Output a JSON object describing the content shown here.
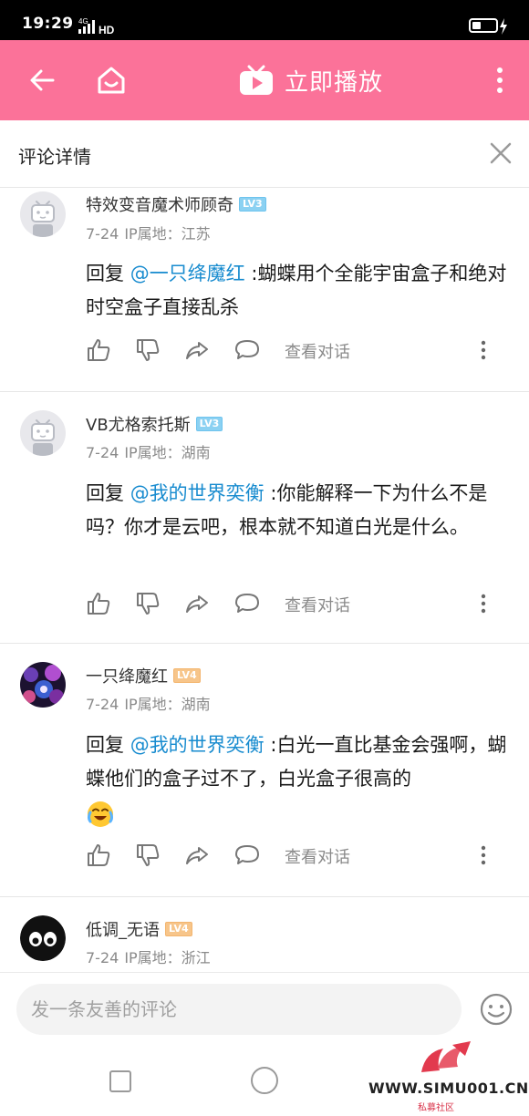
{
  "status_bar": {
    "time": "19:29",
    "network": "4G",
    "hd": "HD"
  },
  "header": {
    "play_label": "立即播放",
    "accent_color": "#fb7299"
  },
  "subheader": {
    "title": "评论详情"
  },
  "comments": [
    {
      "username": "特效变音魔术师顾奇",
      "level": "LV3",
      "date": "7-24",
      "ip": "IP属地：江苏",
      "reply_prefix": "回复 ",
      "mention": "@一只绛魔红",
      "text": " :蝴蝶用个全能宇宙盒子和绝对时空盒子直接乱杀",
      "view_dialog": "查看对话"
    },
    {
      "username": "VB尤格索托斯",
      "level": "LV3",
      "date": "7-24",
      "ip": "IP属地：湖南",
      "reply_prefix": "回复 ",
      "mention": "@我的世界奕衡",
      "text": " :你能解释一下为什么不是吗？你才是云吧，根本就不知道白光是什么。",
      "view_dialog": "查看对话"
    },
    {
      "username": "一只绛魔红",
      "level": "LV4",
      "date": "7-24",
      "ip": "IP属地：湖南",
      "reply_prefix": "回复 ",
      "mention": "@我的世界奕衡",
      "text": " :白光一直比基金会强啊，蝴蝶他们的盒子过不了，白光盒子很高的",
      "view_dialog": "查看对话"
    },
    {
      "username": "低调_无语",
      "level": "LV4",
      "date": "7-24",
      "ip": "IP属地：浙江"
    }
  ],
  "input": {
    "placeholder": "发一条友善的评论"
  },
  "watermark": {
    "text": "WWW.SIMU001.CN",
    "sub": "私募社区"
  }
}
